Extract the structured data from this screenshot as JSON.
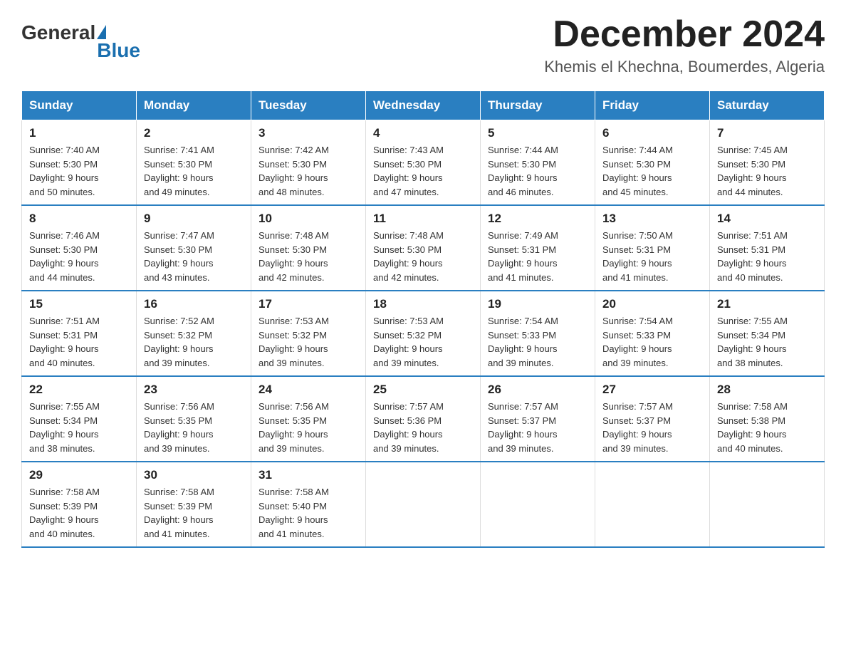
{
  "logo": {
    "general": "General",
    "blue": "Blue"
  },
  "header": {
    "month_year": "December 2024",
    "location": "Khemis el Khechna, Boumerdes, Algeria"
  },
  "weekdays": [
    "Sunday",
    "Monday",
    "Tuesday",
    "Wednesday",
    "Thursday",
    "Friday",
    "Saturday"
  ],
  "weeks": [
    [
      {
        "day": "1",
        "sunrise": "7:40 AM",
        "sunset": "5:30 PM",
        "daylight": "9 hours and 50 minutes."
      },
      {
        "day": "2",
        "sunrise": "7:41 AM",
        "sunset": "5:30 PM",
        "daylight": "9 hours and 49 minutes."
      },
      {
        "day": "3",
        "sunrise": "7:42 AM",
        "sunset": "5:30 PM",
        "daylight": "9 hours and 48 minutes."
      },
      {
        "day": "4",
        "sunrise": "7:43 AM",
        "sunset": "5:30 PM",
        "daylight": "9 hours and 47 minutes."
      },
      {
        "day": "5",
        "sunrise": "7:44 AM",
        "sunset": "5:30 PM",
        "daylight": "9 hours and 46 minutes."
      },
      {
        "day": "6",
        "sunrise": "7:44 AM",
        "sunset": "5:30 PM",
        "daylight": "9 hours and 45 minutes."
      },
      {
        "day": "7",
        "sunrise": "7:45 AM",
        "sunset": "5:30 PM",
        "daylight": "9 hours and 44 minutes."
      }
    ],
    [
      {
        "day": "8",
        "sunrise": "7:46 AM",
        "sunset": "5:30 PM",
        "daylight": "9 hours and 44 minutes."
      },
      {
        "day": "9",
        "sunrise": "7:47 AM",
        "sunset": "5:30 PM",
        "daylight": "9 hours and 43 minutes."
      },
      {
        "day": "10",
        "sunrise": "7:48 AM",
        "sunset": "5:30 PM",
        "daylight": "9 hours and 42 minutes."
      },
      {
        "day": "11",
        "sunrise": "7:48 AM",
        "sunset": "5:30 PM",
        "daylight": "9 hours and 42 minutes."
      },
      {
        "day": "12",
        "sunrise": "7:49 AM",
        "sunset": "5:31 PM",
        "daylight": "9 hours and 41 minutes."
      },
      {
        "day": "13",
        "sunrise": "7:50 AM",
        "sunset": "5:31 PM",
        "daylight": "9 hours and 41 minutes."
      },
      {
        "day": "14",
        "sunrise": "7:51 AM",
        "sunset": "5:31 PM",
        "daylight": "9 hours and 40 minutes."
      }
    ],
    [
      {
        "day": "15",
        "sunrise": "7:51 AM",
        "sunset": "5:31 PM",
        "daylight": "9 hours and 40 minutes."
      },
      {
        "day": "16",
        "sunrise": "7:52 AM",
        "sunset": "5:32 PM",
        "daylight": "9 hours and 39 minutes."
      },
      {
        "day": "17",
        "sunrise": "7:53 AM",
        "sunset": "5:32 PM",
        "daylight": "9 hours and 39 minutes."
      },
      {
        "day": "18",
        "sunrise": "7:53 AM",
        "sunset": "5:32 PM",
        "daylight": "9 hours and 39 minutes."
      },
      {
        "day": "19",
        "sunrise": "7:54 AM",
        "sunset": "5:33 PM",
        "daylight": "9 hours and 39 minutes."
      },
      {
        "day": "20",
        "sunrise": "7:54 AM",
        "sunset": "5:33 PM",
        "daylight": "9 hours and 39 minutes."
      },
      {
        "day": "21",
        "sunrise": "7:55 AM",
        "sunset": "5:34 PM",
        "daylight": "9 hours and 38 minutes."
      }
    ],
    [
      {
        "day": "22",
        "sunrise": "7:55 AM",
        "sunset": "5:34 PM",
        "daylight": "9 hours and 38 minutes."
      },
      {
        "day": "23",
        "sunrise": "7:56 AM",
        "sunset": "5:35 PM",
        "daylight": "9 hours and 39 minutes."
      },
      {
        "day": "24",
        "sunrise": "7:56 AM",
        "sunset": "5:35 PM",
        "daylight": "9 hours and 39 minutes."
      },
      {
        "day": "25",
        "sunrise": "7:57 AM",
        "sunset": "5:36 PM",
        "daylight": "9 hours and 39 minutes."
      },
      {
        "day": "26",
        "sunrise": "7:57 AM",
        "sunset": "5:37 PM",
        "daylight": "9 hours and 39 minutes."
      },
      {
        "day": "27",
        "sunrise": "7:57 AM",
        "sunset": "5:37 PM",
        "daylight": "9 hours and 39 minutes."
      },
      {
        "day": "28",
        "sunrise": "7:58 AM",
        "sunset": "5:38 PM",
        "daylight": "9 hours and 40 minutes."
      }
    ],
    [
      {
        "day": "29",
        "sunrise": "7:58 AM",
        "sunset": "5:39 PM",
        "daylight": "9 hours and 40 minutes."
      },
      {
        "day": "30",
        "sunrise": "7:58 AM",
        "sunset": "5:39 PM",
        "daylight": "9 hours and 41 minutes."
      },
      {
        "day": "31",
        "sunrise": "7:58 AM",
        "sunset": "5:40 PM",
        "daylight": "9 hours and 41 minutes."
      },
      null,
      null,
      null,
      null
    ]
  ],
  "labels": {
    "sunrise": "Sunrise:",
    "sunset": "Sunset:",
    "daylight": "Daylight:"
  }
}
